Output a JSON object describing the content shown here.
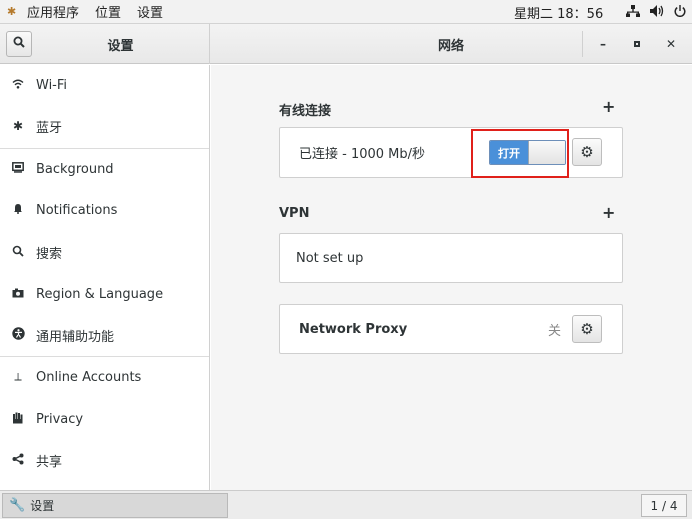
{
  "top_panel": {
    "menu": [
      "应用程序",
      "位置",
      "设置"
    ],
    "clock": "星期二 18：56"
  },
  "titlebar": {
    "left_title": "设置",
    "center_title": "网络"
  },
  "sidebar": {
    "items": [
      {
        "label": "Wi-Fi",
        "icon": "wifi-icon"
      },
      {
        "label": "蓝牙",
        "icon": "bluetooth-icon"
      },
      {
        "label": "Background",
        "icon": "background-icon"
      },
      {
        "label": "Notifications",
        "icon": "bell-icon"
      },
      {
        "label": "搜索",
        "icon": "search-icon"
      },
      {
        "label": "Region & Language",
        "icon": "camera-icon"
      },
      {
        "label": "通用辅助功能",
        "icon": "accessibility-icon"
      },
      {
        "label": "Online Accounts",
        "icon": "online-accounts-icon"
      },
      {
        "label": "Privacy",
        "icon": "hand-icon"
      },
      {
        "label": "共享",
        "icon": "share-icon"
      }
    ]
  },
  "main": {
    "wired": {
      "title": "有线连接",
      "status": "已连接 - 1000 Mb/秒",
      "toggle_label": "打开"
    },
    "vpn": {
      "title": "VPN",
      "status": "Not set up"
    },
    "proxy": {
      "label": "Network Proxy",
      "state": "关"
    }
  },
  "taskbar": {
    "task_label": "设置",
    "pager": "1 / 4"
  },
  "colors": {
    "accent": "#4a90d9",
    "highlight_box": "#e0201a"
  }
}
